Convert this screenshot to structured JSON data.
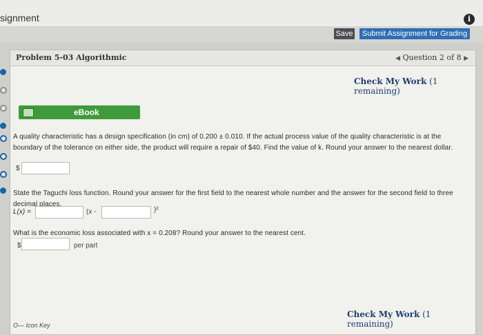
{
  "window": {
    "assignment_title": "signment",
    "info_icon": "info-icon"
  },
  "toolbar": {
    "save_label": "Save",
    "submit_label": "Submit Assignment for Grading"
  },
  "problem": {
    "title": "Problem 5-03 Algorithmic",
    "nav_label": "Question 2 of 8",
    "prev_icon": "chevron-left-icon",
    "next_icon": "chevron-right-icon"
  },
  "check": {
    "label": "Check My Work",
    "remaining": "(1 remaining)"
  },
  "ebook": {
    "label": "eBook",
    "icon": "book-icon"
  },
  "questions": {
    "q1_text": "A quality characteristic has a design specification (in cm) of 0.200 ± 0.010. If the actual process value of the quality characteristic is at the boundary of the tolerance on either side, the product will require a repair of $40. Find the value of k. Round your answer to the nearest dollar.",
    "q1_currency": "$",
    "q1_value": "",
    "q2_text": "State the Taguchi loss function. Round your answer for the first field to the nearest whole number and the answer for the second field to three decimal places.",
    "q2_lhs": "L(x) =",
    "q2_mid": "(x -",
    "q2_close": ")²",
    "q2_field1": "",
    "q2_field2": "",
    "q3_text": "What is the economic loss associated with x = 0.208? Round your answer to the nearest cent.",
    "q3_currency": "$",
    "q3_value": "",
    "q3_unit": "per part"
  },
  "footer": {
    "icon_key": "O— Icon Key"
  },
  "colors": {
    "submit_blue": "#2f6db5",
    "ebook_green": "#3f9a3a",
    "save_dark": "#4a4d52",
    "rail_blue": "#1b63a8"
  }
}
